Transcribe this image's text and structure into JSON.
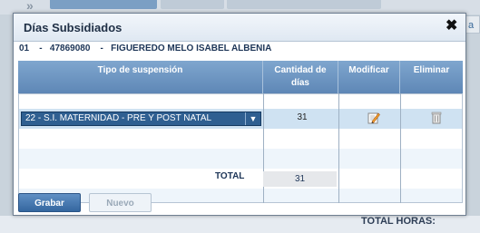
{
  "dialog": {
    "title": "Días Subsidiados",
    "close_glyph": "✖",
    "person": {
      "code": "01",
      "doc": "47869080",
      "name": "FIGUEREDO MELO ISABEL ALBENIA",
      "line": "01    -   47869080    -   FIGUEREDO MELO ISABEL ALBENIA"
    }
  },
  "table": {
    "headers": {
      "tipo": "Tipo de suspensión",
      "cantidad_1": "Cantidad de",
      "cantidad_2": "días",
      "modificar": "Modificar",
      "eliminar": "Eliminar"
    },
    "rows": [
      {
        "tipo": "22 - S.I. MATERNIDAD - PRE Y POST NATAL",
        "cantidad": "31"
      }
    ]
  },
  "totals": {
    "label": "TOTAL",
    "value": "31"
  },
  "buttons": {
    "grabar": "Grabar",
    "nuevo": "Nuevo"
  },
  "background": {
    "total_horas": "TOTAL HORAS:",
    "arrows": "»",
    "right_tab": "a F"
  },
  "colors": {
    "header": "#6b93c0",
    "primary_button": "#3f6fa6",
    "selected_row": "#cfe2f2"
  },
  "icons": {
    "edit": "edit-pencil-icon",
    "delete": "trash-icon",
    "dropdown": "dropdown-arrow-icon"
  }
}
